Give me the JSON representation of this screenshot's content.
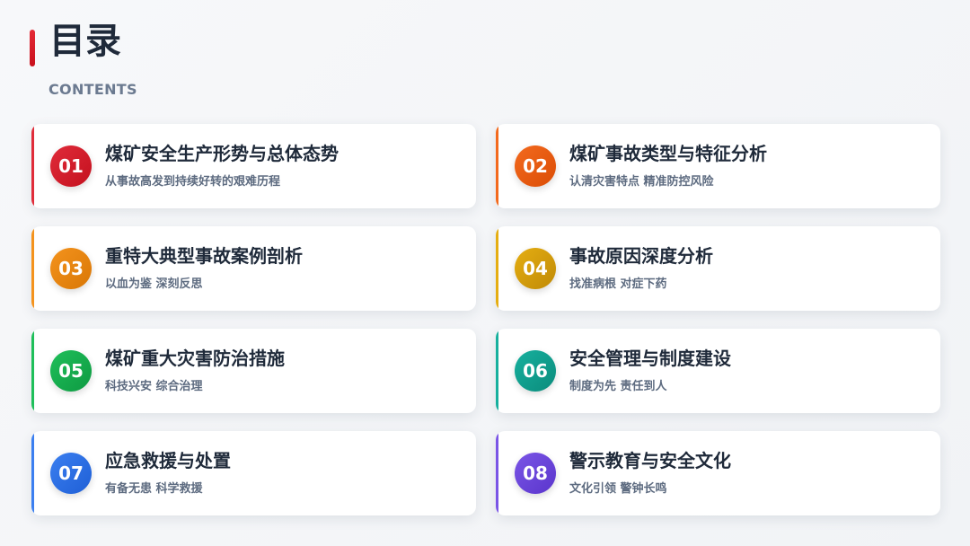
{
  "header": {
    "title": "目录",
    "subtitle": "CONTENTS",
    "accent_color": "#d91c28"
  },
  "items": [
    {
      "number": "01",
      "title": "煤矿安全生产形势与总体态势",
      "desc": "从事故高发到持续好转的艰难历程",
      "color": "#e02c3a",
      "color_dark": "#c4101e"
    },
    {
      "number": "02",
      "title": "煤矿事故类型与特征分析",
      "desc": "认清灾害特点 精准防控风险",
      "color": "#f36a1e",
      "color_dark": "#db4d06"
    },
    {
      "number": "03",
      "title": "重特大典型事故案例剖析",
      "desc": "以血为鉴 深刻反思",
      "color": "#f4931d",
      "color_dark": "#d97706"
    },
    {
      "number": "04",
      "title": "事故原因深度分析",
      "desc": "找准病根 对症下药",
      "color": "#e5ae12",
      "color_dark": "#c08a06"
    },
    {
      "number": "05",
      "title": "煤矿重大灾害防治措施",
      "desc": "科技兴安 综合治理",
      "color": "#1fbf5a",
      "color_dark": "#0e9a42"
    },
    {
      "number": "06",
      "title": "安全管理与制度建设",
      "desc": "制度为先 责任到人",
      "color": "#17b09e",
      "color_dark": "#0b8c7c"
    },
    {
      "number": "07",
      "title": "应急救援与处置",
      "desc": "有备无患 科学救援",
      "color": "#3b7ff0",
      "color_dark": "#1f5fd6"
    },
    {
      "number": "08",
      "title": "警示教育与安全文化",
      "desc": "文化引领 警钟长鸣",
      "color": "#7a55e6",
      "color_dark": "#5a35cc"
    }
  ]
}
